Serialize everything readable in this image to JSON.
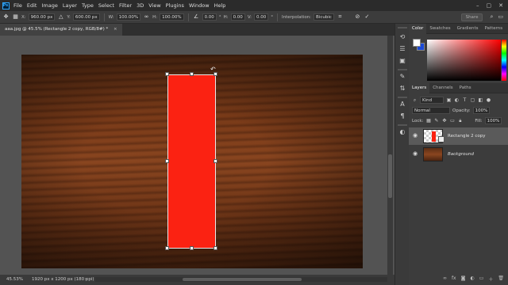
{
  "app": {
    "logo": "Ps",
    "menu": [
      "File",
      "Edit",
      "Image",
      "Layer",
      "Type",
      "Select",
      "Filter",
      "3D",
      "View",
      "Plugins",
      "Window",
      "Help"
    ],
    "window_controls": [
      "minimize-icon",
      "maximize-icon",
      "close-icon"
    ]
  },
  "options_bar": {
    "x_label": "X:",
    "x_value": "960.00 px",
    "y_label": "Y:",
    "y_value": "600.00 px",
    "w_label": "W:",
    "w_value": "100.00%",
    "h_label": "H:",
    "h_value": "100.00%",
    "angle_value": "0.00",
    "h_skew_label": "H:",
    "h_skew_value": "0.00",
    "v_skew_label": "V:",
    "v_skew_value": "0.00",
    "interp_label": "Interpolation:",
    "interp_value": "Bicubic",
    "cancel_icon": "cancel-icon",
    "commit_icon": "checkmark-icon",
    "share_label": "Share"
  },
  "document_tab": {
    "title": "aaa.jpg @ 45.5% (Rectangle 2 copy, RGB/8#) *",
    "close": "×"
  },
  "status_bar": {
    "zoom": "45.53%",
    "doc_size": "1920 px x 1200 px (180 ppi)",
    "arrow": "›"
  },
  "color_panel": {
    "tabs": [
      "Color",
      "Swatches",
      "Gradients",
      "Patterns"
    ],
    "foreground": "#ffffff",
    "background": "#1a4ad6"
  },
  "layers_panel": {
    "tabs": [
      "Layers",
      "Channels",
      "Paths"
    ],
    "filter_value": "Kind",
    "blend_mode": "Normal",
    "opacity_label": "Opacity:",
    "opacity_value": "100%",
    "lock_label": "Lock:",
    "fill_label": "Fill:",
    "fill_value": "100%",
    "layers": [
      {
        "name": "Rectangle 2 copy",
        "selected": true
      },
      {
        "name": "Background",
        "selected": false
      }
    ]
  },
  "colors": {
    "rectangle_fill": "#fb2212",
    "panel_bg": "#3c3c3c",
    "menubar_bg": "#2b2b2b"
  }
}
